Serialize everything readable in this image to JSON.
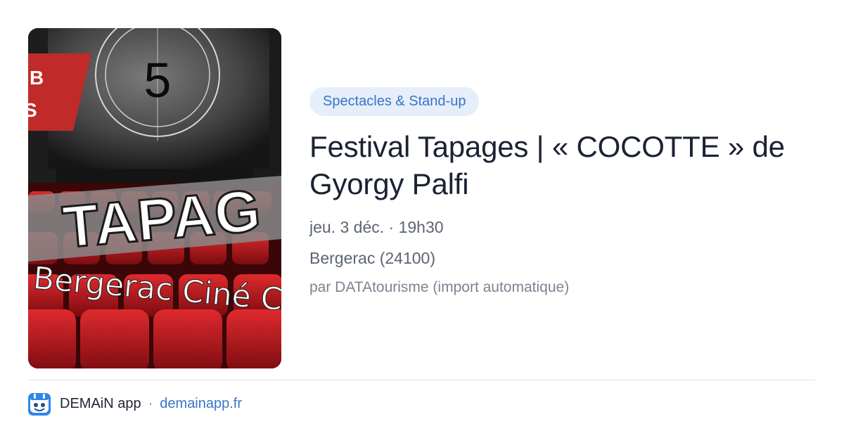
{
  "poster": {
    "countdown_number": "5",
    "banner_letters": [
      "B",
      "S"
    ],
    "headline": "TAPAG",
    "subline": "Bergerac Ciné C",
    "colors": {
      "seat_red": "#c4161c",
      "banner_red": "#c02a28",
      "screen_gray": "#5a5a5a"
    }
  },
  "event": {
    "category": "Spectacles & Stand-up",
    "title": "Festival Tapages | « COCOTTE » de Gyorgy Palfi",
    "datetime": "jeu. 3 déc. · 19h30",
    "location": "Bergerac (24100)",
    "source": "par DATAtourisme (import automatique)"
  },
  "footer": {
    "app_icon": "demain-app-icon",
    "app_name": "DEMAiN app",
    "separator": "·",
    "site": "demainapp.fr"
  },
  "colors": {
    "accent": "#3a74c9",
    "pill_bg": "#e6eef9",
    "title": "#1a2233",
    "meta": "#5c6573"
  }
}
